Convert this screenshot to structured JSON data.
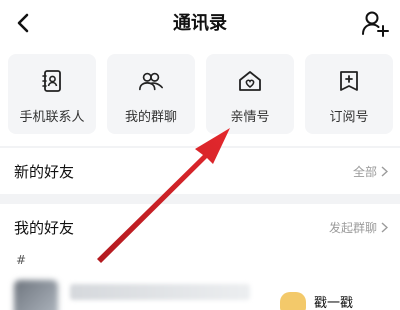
{
  "header": {
    "title": "通讯录",
    "back_icon": "chevron-left-icon",
    "add_icon": "add-person-icon"
  },
  "grid": [
    {
      "label": "手机联系人",
      "icon": "phone-contacts-icon"
    },
    {
      "label": "我的群聊",
      "icon": "group-icon"
    },
    {
      "label": "亲情号",
      "icon": "home-heart-icon"
    },
    {
      "label": "订阅号",
      "icon": "plus-box-icon"
    }
  ],
  "new_friends": {
    "title": "新的好友",
    "action": "全部"
  },
  "my_friends": {
    "title": "我的好友",
    "action": "发起群聊"
  },
  "index_letter": "#",
  "contact": {
    "poke_label": "戳一戳"
  },
  "colors": {
    "annotation_arrow": "#d8262c",
    "secondary_text": "#9b9b9b"
  }
}
